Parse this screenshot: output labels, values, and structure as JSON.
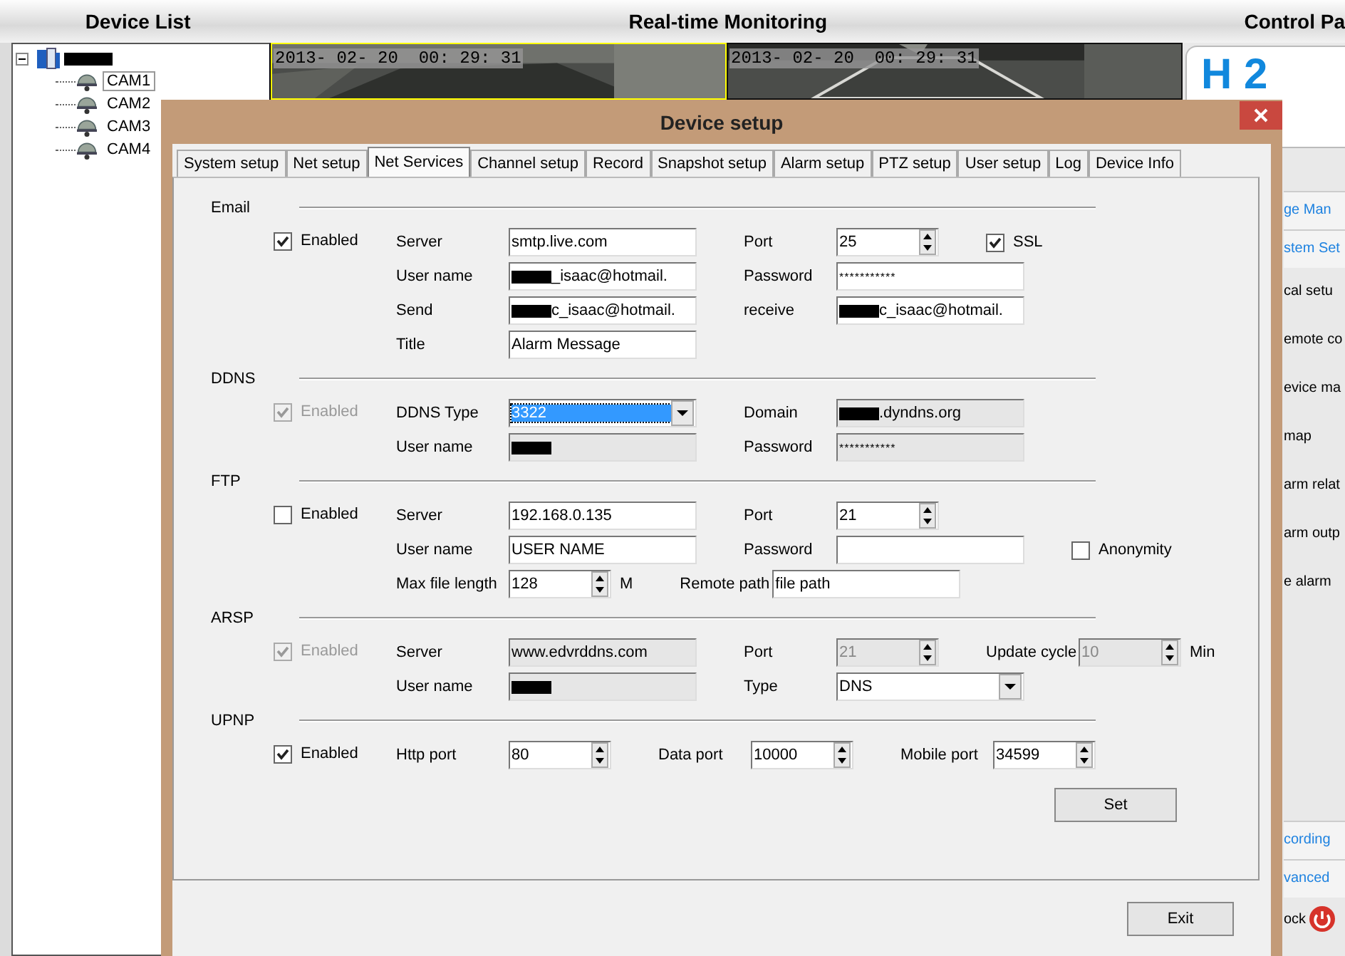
{
  "header": {
    "titles": [
      "Device List",
      "Real-time Monitoring",
      "Control Pa"
    ]
  },
  "device_tree": {
    "root": {
      "expanded": true,
      "redacted": true,
      "children": [
        {
          "label": "CAM1",
          "selected": true
        },
        {
          "label": "CAM2",
          "selected": false
        },
        {
          "label": "CAM3",
          "selected": false
        },
        {
          "label": "CAM4",
          "selected": false
        }
      ]
    }
  },
  "video_tiles": [
    {
      "kind": "picture",
      "timestamp": "2013- 02- 20  00: 29: 31",
      "selected": true
    },
    {
      "kind": "picture",
      "timestamp": "2013- 02- 20  00: 29: 31",
      "selected": false
    }
  ],
  "control_panel": {
    "logo": "H 2",
    "items": [
      {
        "kind": "tab",
        "label": "ge Man"
      },
      {
        "kind": "tab",
        "label": "stem Set"
      },
      {
        "kind": "item",
        "label": "cal setu"
      },
      {
        "kind": "item",
        "label": "emote co"
      },
      {
        "kind": "item",
        "label": "evice ma"
      },
      {
        "kind": "item",
        "label": "map"
      },
      {
        "kind": "item",
        "label": "arm relat"
      },
      {
        "kind": "item",
        "label": "arm outp"
      },
      {
        "kind": "item",
        "label": "e alarm"
      },
      {
        "kind": "gap"
      },
      {
        "kind": "tab",
        "label": "cording"
      },
      {
        "kind": "tab",
        "label": "vanced"
      },
      {
        "kind": "power",
        "label": "ock"
      }
    ]
  },
  "dialog": {
    "title": "Device setup",
    "tabs": [
      {
        "label": "System setup",
        "selected": false
      },
      {
        "label": "Net setup",
        "selected": false
      },
      {
        "label": "Net Services",
        "selected": true
      },
      {
        "label": "Channel setup",
        "selected": false
      },
      {
        "label": "Record",
        "selected": false
      },
      {
        "label": "Snapshot setup",
        "selected": false
      },
      {
        "label": "Alarm setup",
        "selected": false
      },
      {
        "label": "PTZ setup",
        "selected": false
      },
      {
        "label": "User setup",
        "selected": false
      },
      {
        "label": "Log",
        "selected": false
      },
      {
        "label": "Device Info",
        "selected": false
      }
    ],
    "sections": [
      {
        "title": "Email",
        "enabled": {
          "label": "Enabled",
          "checked": true,
          "disabled": false
        },
        "rows": [
          [
            {
              "kind": "text",
              "label": "Server",
              "value": "smtp.live.com",
              "disabled": false
            },
            {
              "kind": "spin",
              "label": "Port",
              "value": "25",
              "disabled": false
            },
            {
              "kind": "checkbox",
              "label": "SSL",
              "checked": true
            }
          ],
          [
            {
              "kind": "text",
              "label": "User name",
              "value": "_isaac@hotmail.",
              "redacted": true,
              "disabled": false
            },
            {
              "kind": "text",
              "label": "Password",
              "value": "***********",
              "disabled": false
            }
          ],
          [
            {
              "kind": "text",
              "label": "Send",
              "value": "c_isaac@hotmail.",
              "redacted": true,
              "disabled": false
            },
            {
              "kind": "text",
              "label": "receive",
              "value": "c_isaac@hotmail.",
              "redacted": true,
              "disabled": false
            }
          ],
          [
            {
              "kind": "text",
              "label": "Title",
              "value": "Alarm Message",
              "disabled": false
            }
          ]
        ]
      },
      {
        "title": "DDNS",
        "enabled": {
          "label": "Enabled",
          "checked": true,
          "disabled": true
        },
        "rows": [
          [
            {
              "kind": "select",
              "label": "DDNS Type",
              "value": "3322",
              "highlighted": true,
              "disabled": false
            },
            {
              "kind": "text",
              "label": "Domain",
              "value": ".dyndns.org",
              "redacted": true,
              "disabled": true
            }
          ],
          [
            {
              "kind": "text",
              "label": "User name",
              "redacted": true,
              "disabled": true
            },
            {
              "kind": "text",
              "label": "Password",
              "value": "***********",
              "disabled": true
            }
          ]
        ]
      },
      {
        "title": "FTP",
        "enabled": {
          "label": "Enabled",
          "checked": false,
          "disabled": false
        },
        "rows": [
          [
            {
              "kind": "text",
              "label": "Server",
              "value": "192.168.0.135",
              "disabled": false
            },
            {
              "kind": "spin",
              "label": "Port",
              "value": "21",
              "disabled": false
            }
          ],
          [
            {
              "kind": "text",
              "label": "User name",
              "value": "USER NAME",
              "disabled": false
            },
            {
              "kind": "text",
              "label": "Password",
              "disabled": false
            },
            {
              "kind": "checkbox",
              "label": "Anonymity",
              "checked": false
            }
          ],
          [
            {
              "kind": "spin",
              "label": "Max file length",
              "value": "128",
              "unit": "M",
              "disabled": false
            },
            {
              "kind": "text",
              "label": "Remote path",
              "value": "file path",
              "disabled": false
            }
          ]
        ]
      },
      {
        "title": "ARSP",
        "enabled": {
          "label": "Enabled",
          "checked": true,
          "disabled": true
        },
        "rows": [
          [
            {
              "kind": "text",
              "label": "Server",
              "value": "www.edvrddns.com",
              "disabled": true
            },
            {
              "kind": "spin",
              "label": "Port",
              "value": "21",
              "disabled": true
            },
            {
              "kind": "spin",
              "label": "Update cycle",
              "value": "10",
              "unit": "Min",
              "disabled": true
            }
          ],
          [
            {
              "kind": "text",
              "label": "User name",
              "redacted": true,
              "disabled": true
            },
            {
              "kind": "select",
              "label": "Type",
              "value": "DNS",
              "highlighted": false,
              "disabled": false
            }
          ]
        ]
      },
      {
        "title": "UPNP",
        "enabled": {
          "label": "Enabled",
          "checked": true,
          "disabled": false
        },
        "rows": [
          [
            {
              "kind": "spin",
              "label": "Http port",
              "value": "80",
              "disabled": false
            },
            {
              "kind": "spin",
              "label": "Data port",
              "value": "10000",
              "disabled": false
            },
            {
              "kind": "spin",
              "label": "Mobile port",
              "value": "34599",
              "disabled": false
            }
          ]
        ]
      }
    ],
    "set_button": "Set",
    "exit_button": "Exit"
  }
}
